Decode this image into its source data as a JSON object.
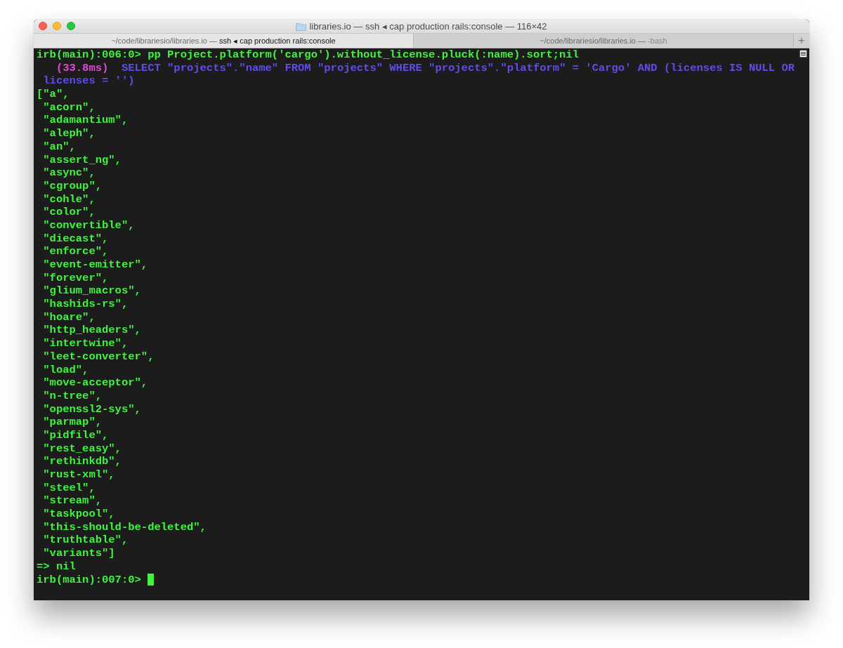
{
  "window": {
    "title": "libraries.io — ssh ◂ cap production rails:console — 116×42"
  },
  "tabs": [
    {
      "path": "~/code/librariesio/libraries.io —",
      "process": "ssh ◂ cap production rails:console",
      "selected": true
    },
    {
      "path": "~/code/librariesio/libraries.io —",
      "process": "-bash",
      "selected": false
    }
  ],
  "new_tab_button": "+",
  "terminal": {
    "cursor_visible": true,
    "lines": [
      {
        "segments": [
          {
            "kind": "text",
            "text": "irb(main):006:0> pp Project.platform('cargo').without_license.pluck(:name).sort;nil"
          }
        ]
      },
      {
        "segments": [
          {
            "kind": "timing",
            "text": "   (33.8ms)"
          },
          {
            "kind": "sql",
            "text": "  SELECT \"projects\".\"name\" FROM \"projects\" WHERE \"projects\".\"platform\" = 'Cargo' AND (licenses IS NULL OR"
          }
        ]
      },
      {
        "segments": [
          {
            "kind": "sql",
            "text": " licenses = '')"
          }
        ]
      },
      {
        "segments": [
          {
            "kind": "text",
            "text": "[\"a\","
          }
        ]
      },
      {
        "segments": [
          {
            "kind": "text",
            "text": " \"acorn\","
          }
        ]
      },
      {
        "segments": [
          {
            "kind": "text",
            "text": " \"adamantium\","
          }
        ]
      },
      {
        "segments": [
          {
            "kind": "text",
            "text": " \"aleph\","
          }
        ]
      },
      {
        "segments": [
          {
            "kind": "text",
            "text": " \"an\","
          }
        ]
      },
      {
        "segments": [
          {
            "kind": "text",
            "text": " \"assert_ng\","
          }
        ]
      },
      {
        "segments": [
          {
            "kind": "text",
            "text": " \"async\","
          }
        ]
      },
      {
        "segments": [
          {
            "kind": "text",
            "text": " \"cgroup\","
          }
        ]
      },
      {
        "segments": [
          {
            "kind": "text",
            "text": " \"cohle\","
          }
        ]
      },
      {
        "segments": [
          {
            "kind": "text",
            "text": " \"color\","
          }
        ]
      },
      {
        "segments": [
          {
            "kind": "text",
            "text": " \"convertible\","
          }
        ]
      },
      {
        "segments": [
          {
            "kind": "text",
            "text": " \"diecast\","
          }
        ]
      },
      {
        "segments": [
          {
            "kind": "text",
            "text": " \"enforce\","
          }
        ]
      },
      {
        "segments": [
          {
            "kind": "text",
            "text": " \"event-emitter\","
          }
        ]
      },
      {
        "segments": [
          {
            "kind": "text",
            "text": " \"forever\","
          }
        ]
      },
      {
        "segments": [
          {
            "kind": "text",
            "text": " \"glium_macros\","
          }
        ]
      },
      {
        "segments": [
          {
            "kind": "text",
            "text": " \"hashids-rs\","
          }
        ]
      },
      {
        "segments": [
          {
            "kind": "text",
            "text": " \"hoare\","
          }
        ]
      },
      {
        "segments": [
          {
            "kind": "text",
            "text": " \"http_headers\","
          }
        ]
      },
      {
        "segments": [
          {
            "kind": "text",
            "text": " \"intertwine\","
          }
        ]
      },
      {
        "segments": [
          {
            "kind": "text",
            "text": " \"leet-converter\","
          }
        ]
      },
      {
        "segments": [
          {
            "kind": "text",
            "text": " \"load\","
          }
        ]
      },
      {
        "segments": [
          {
            "kind": "text",
            "text": " \"move-acceptor\","
          }
        ]
      },
      {
        "segments": [
          {
            "kind": "text",
            "text": " \"n-tree\","
          }
        ]
      },
      {
        "segments": [
          {
            "kind": "text",
            "text": " \"openssl2-sys\","
          }
        ]
      },
      {
        "segments": [
          {
            "kind": "text",
            "text": " \"parmap\","
          }
        ]
      },
      {
        "segments": [
          {
            "kind": "text",
            "text": " \"pidfile\","
          }
        ]
      },
      {
        "segments": [
          {
            "kind": "text",
            "text": " \"rest_easy\","
          }
        ]
      },
      {
        "segments": [
          {
            "kind": "text",
            "text": " \"rethinkdb\","
          }
        ]
      },
      {
        "segments": [
          {
            "kind": "text",
            "text": " \"rust-xml\","
          }
        ]
      },
      {
        "segments": [
          {
            "kind": "text",
            "text": " \"steel\","
          }
        ]
      },
      {
        "segments": [
          {
            "kind": "text",
            "text": " \"stream\","
          }
        ]
      },
      {
        "segments": [
          {
            "kind": "text",
            "text": " \"taskpool\","
          }
        ]
      },
      {
        "segments": [
          {
            "kind": "text",
            "text": " \"this-should-be-deleted\","
          }
        ]
      },
      {
        "segments": [
          {
            "kind": "text",
            "text": " \"truthtable\","
          }
        ]
      },
      {
        "segments": [
          {
            "kind": "text",
            "text": " \"variants\"]"
          }
        ]
      },
      {
        "segments": [
          {
            "kind": "text",
            "text": "=> nil"
          }
        ]
      },
      {
        "segments": [
          {
            "kind": "text",
            "text": "irb(main):007:0> "
          }
        ]
      }
    ]
  }
}
